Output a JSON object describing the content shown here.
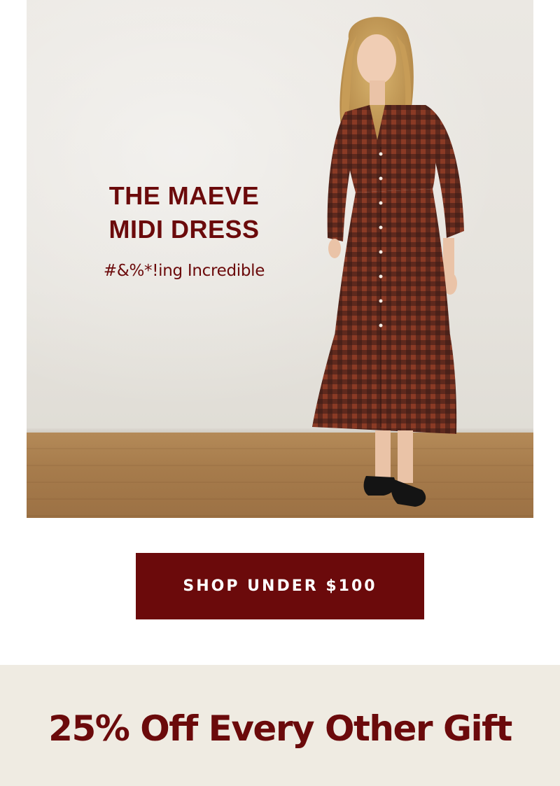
{
  "hero": {
    "title_line1": "THE MAEVE",
    "title_line2": "MIDI DRESS",
    "tagline": "#&%*!ing Incredible",
    "image_alt": "model-in-gingham-midi-dress"
  },
  "cta": {
    "label": "SHOP UNDER $100"
  },
  "promo": {
    "text": "25% Off Every Other Gift"
  },
  "colors": {
    "brand": "#6b0a0b",
    "promo_background": "#efebe2",
    "white": "#ffffff"
  }
}
